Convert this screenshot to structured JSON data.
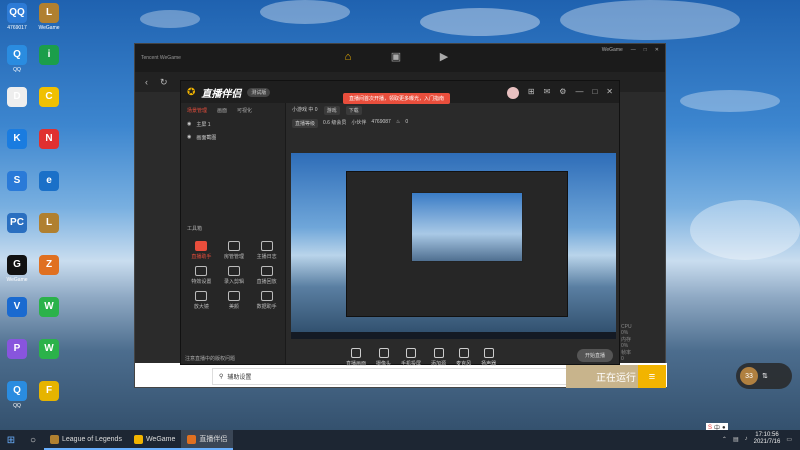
{
  "desktop": {
    "icons": [
      {
        "label": "4769017",
        "color": "#2d7bd6",
        "glyph": "QQ"
      },
      {
        "label": "WeGame",
        "color": "#b08030",
        "glyph": "L"
      },
      {
        "label": "QQ",
        "color": "#2a8ce0",
        "glyph": "Q"
      },
      {
        "label": "",
        "color": "#1b9e4a",
        "glyph": "i"
      },
      {
        "label": "",
        "color": "#eee",
        "glyph": "D"
      },
      {
        "label": "",
        "color": "#f0c000",
        "glyph": "C"
      },
      {
        "label": "",
        "color": "#1a7ce0",
        "glyph": "K"
      },
      {
        "label": "",
        "color": "#e03030",
        "glyph": "N"
      },
      {
        "label": "",
        "color": "#2a7ad8",
        "glyph": "S"
      },
      {
        "label": "",
        "color": "#1a70c8",
        "glyph": "e"
      },
      {
        "label": "",
        "color": "#2a6fc0",
        "glyph": "PC"
      },
      {
        "label": "",
        "color": "#b08030",
        "glyph": "L"
      },
      {
        "label": "WeGame",
        "color": "#111",
        "glyph": "G"
      },
      {
        "label": "",
        "color": "#e07020",
        "glyph": "Z"
      },
      {
        "label": "",
        "color": "#1a6ad0",
        "glyph": "V"
      },
      {
        "label": "",
        "color": "#2bb24a",
        "glyph": "W"
      },
      {
        "label": "",
        "color": "#8855dd",
        "glyph": "P"
      },
      {
        "label": "",
        "color": "#2bb24a",
        "glyph": "W"
      },
      {
        "label": "QQ",
        "color": "#2a8ce0",
        "glyph": "Q"
      },
      {
        "label": "",
        "color": "#e6b400",
        "glyph": "F"
      }
    ]
  },
  "wegame": {
    "brand": "Tencent WeGame",
    "user": "WeGame",
    "bottom": {
      "search_placeholder": "辅助设置",
      "run_button": "正在运行",
      "menu_glyph": "≡"
    }
  },
  "zhibo": {
    "logo": "直播伴侣",
    "tag": "测试版",
    "banner": "直播间首次开播，领取更多曝光，入门指南",
    "tabs": [
      "场景管理",
      "画面",
      "可视化"
    ],
    "scenes": [
      {
        "label": "主屏 1",
        "active": true
      },
      {
        "label": "画面截图",
        "active": false
      }
    ],
    "info": {
      "line1": "小游戏 中 0",
      "tag1": "游戏",
      "tag2": "下载",
      "level_label": "直播等级",
      "level_value": "0.6 级会员",
      "fans_label": "小伙伴",
      "fans_value": "4769087",
      "likes": "0"
    },
    "tools_heading": "工具箱",
    "tools": [
      {
        "label": "直播助手",
        "active": true
      },
      {
        "label": "房管管理",
        "active": false
      },
      {
        "label": "主播日志",
        "active": false
      },
      {
        "label": "特效设置",
        "active": false
      },
      {
        "label": "录入剪辑",
        "active": false
      },
      {
        "label": "直播回放",
        "active": false
      },
      {
        "label": "放大镜",
        "active": false
      },
      {
        "label": "美颜",
        "active": false
      },
      {
        "label": "数据助手",
        "active": false
      }
    ],
    "controls": [
      "直播画面",
      "摄像头",
      "手机投屏",
      "添加源",
      "麦克风",
      "扬声器"
    ],
    "start_button": "开始直播",
    "footer_left": "注意直播中的版权问题",
    "footer_right": "CPU 0%  内存 0%  帧率 0"
  },
  "gauge": {
    "value": "33"
  },
  "taskbar": {
    "apps": [
      {
        "label": "League of Legends",
        "color": "#b08030"
      },
      {
        "label": "WeGame",
        "color": "#f2b400"
      },
      {
        "label": "直播伴侣",
        "color": "#e07020"
      }
    ],
    "time": "17:10:56",
    "date": "2021/7/16",
    "ime": "中"
  }
}
